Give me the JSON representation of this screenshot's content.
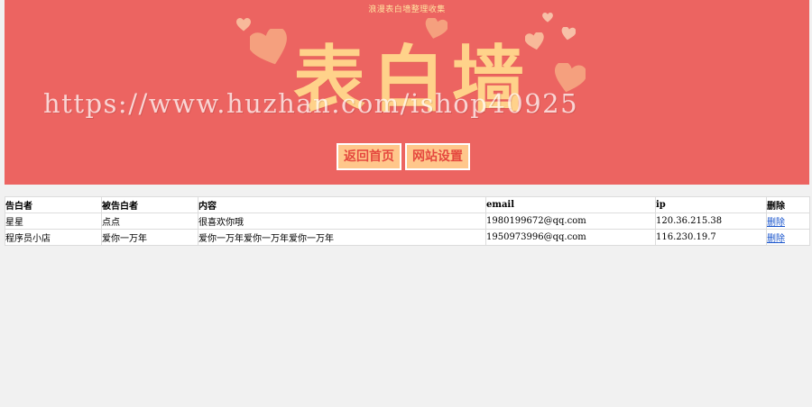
{
  "banner": {
    "subtitle": "浪漫表白墙整理收集",
    "title": "表白墙",
    "watermark": "https://www.huzhan.com/ishop40925",
    "buttons": [
      {
        "label": "返回首页"
      },
      {
        "label": "网站设置"
      }
    ],
    "colors": {
      "background": "#ec6461",
      "title": "#ffd28a",
      "button_bg": "#ffc78b",
      "button_text": "#e5483f",
      "heart": "#f5a07e"
    }
  },
  "table": {
    "headers": [
      "告白者",
      "被告白者",
      "内容",
      "email",
      "ip",
      "删除"
    ],
    "rows": [
      {
        "confessor": "星星",
        "target": "点点",
        "content": "很喜欢你哦",
        "email": "1980199672@qq.com",
        "ip": "120.36.215.38",
        "delete": "删除"
      },
      {
        "confessor": "程序员小店",
        "target": "爱你一万年",
        "content": "爱你一万年爱你一万年爱你一万年",
        "email": "1950973996@qq.com",
        "ip": "116.230.19.7",
        "delete": "删除"
      }
    ]
  }
}
